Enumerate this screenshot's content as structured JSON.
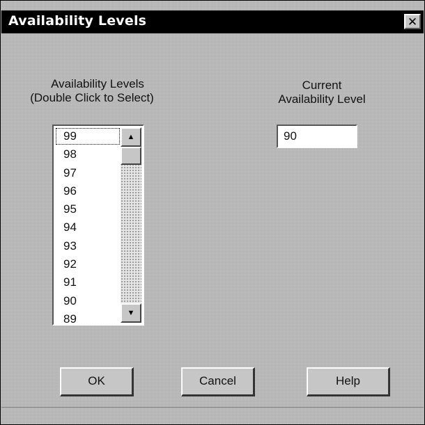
{
  "window": {
    "title": "Availability Levels",
    "close_label": "✕"
  },
  "left_label": {
    "line1": "Availability Levels",
    "line2": "(Double Click to Select)"
  },
  "right_label": {
    "line1": "Current",
    "line2": "Availability Level"
  },
  "listbox": {
    "items": [
      "99",
      "98",
      "97",
      "96",
      "95",
      "94",
      "93",
      "92",
      "91",
      "90",
      "89"
    ],
    "focused_index": 0
  },
  "current_level": "90",
  "buttons": {
    "ok": "OK",
    "cancel": "Cancel",
    "help": "Help"
  },
  "scrollbar": {
    "up_glyph": "▲",
    "down_glyph": "▼"
  }
}
